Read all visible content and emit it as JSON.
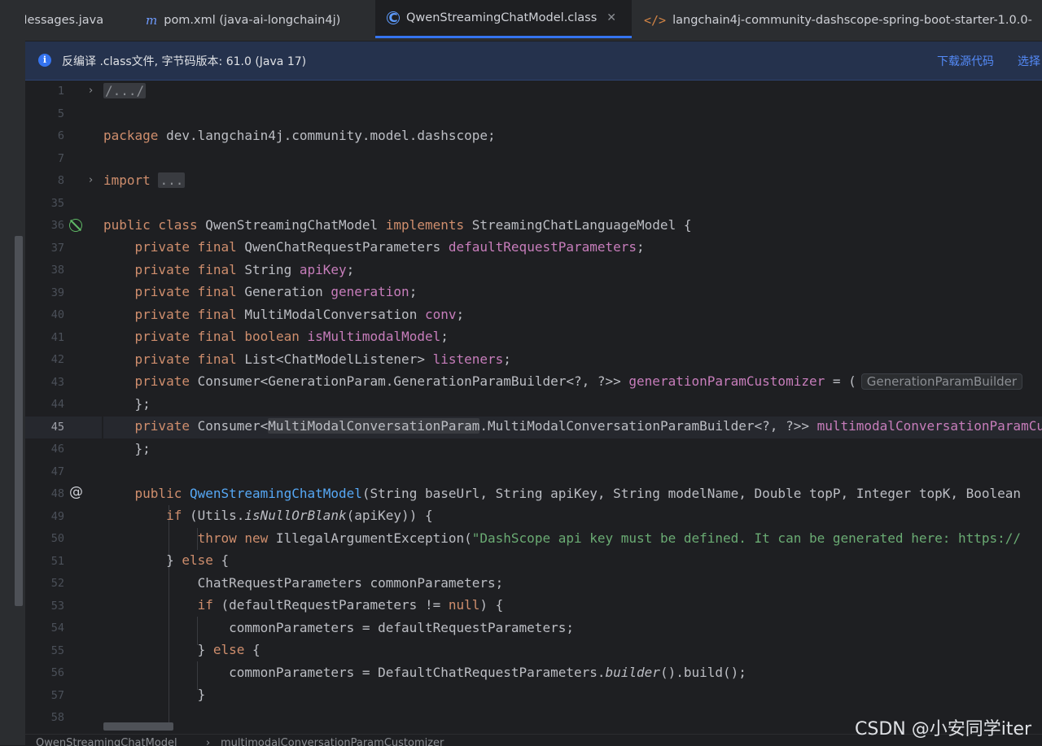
{
  "tabs": [
    {
      "label": "Messages.java",
      "icon": "java-file-icon"
    },
    {
      "label": "pom.xml (java-ai-longchain4j)",
      "icon": "maven-icon"
    },
    {
      "label": "QwenStreamingChatModel.class",
      "icon": "class-icon",
      "active": true
    },
    {
      "label": "langchain4j-community-dashscope-spring-boot-starter-1.0.0-",
      "icon": "xml-icon"
    }
  ],
  "banner": {
    "text": "反编译 .class文件, 字节码版本: 61.0 (Java 17)",
    "download_link": "下载源代码",
    "choose_link": "选择"
  },
  "line_numbers": [
    "1",
    "5",
    "6",
    "7",
    "8",
    "35",
    "36",
    "37",
    "38",
    "39",
    "40",
    "41",
    "42",
    "43",
    "44",
    "45",
    "46",
    "47",
    "48",
    "49",
    "50",
    "51",
    "52",
    "53",
    "54",
    "55",
    "56",
    "57",
    "58"
  ],
  "current_line": "45",
  "code": {
    "l1_fold": "/.../",
    "l6_kw": "package",
    "l6_rest": " dev.langchain4j.community.model.dashscope;",
    "l8_kw": "import",
    "l8_fold": "...",
    "l36_a": "public class",
    "l36_b": " QwenStreamingChatModel ",
    "l36_c": "implements",
    "l36_d": " StreamingChatLanguageModel {",
    "pf": "private final",
    "p": "private",
    "l37_type": " QwenChatRequestParameters ",
    "l37_field": "defaultRequestParameters",
    "semi": ";",
    "l38_type": " String ",
    "l38_field": "apiKey",
    "l39_type": " Generation ",
    "l39_field": "generation",
    "l40_type": " MultiModalConversation ",
    "l40_field": "conv",
    "l41_type": "boolean",
    "l41_field": "isMultimodalModel",
    "l42_type": " List<ChatModelListener> ",
    "l42_field": "listeners",
    "l43_type": " Consumer<GenerationParam.GenerationParamBuilder<?, ?>> ",
    "l43_field": "generationParamCustomizer",
    "l43_rest": " = (",
    "l43_hint": "GenerationParamBuilder",
    "close_brace": "};",
    "l45_a": " Consumer<",
    "l45_hl": "MultiModalConversationParam",
    "l45_b": ".MultiModalConversationParamBuilder<?, ?>> ",
    "l45_field": "multimodalConversationParamCustomizer",
    "l48_kw": "public",
    "l48_fn": "QwenStreamingChatModel",
    "l48_rest": "(String baseUrl, String apiKey, String modelName, Double topP, Integer topK, Boolean",
    "l49_kw": "if",
    "l49_a": " (Utils.",
    "l49_it": "isNullOrBlank",
    "l49_b": "(apiKey)) {",
    "l50_kw": "throw new",
    "l50_a": " IllegalArgumentException(",
    "l50_str": "\"DashScope api key must be defined. It can be generated here: https://",
    "l51_a": "} ",
    "l51_kw": "else",
    "l51_b": " {",
    "l52": "ChatRequestParameters commonParameters;",
    "l53_kw": "if",
    "l53_a": " (defaultRequestParameters != ",
    "l53_null": "null",
    "l53_b": ") {",
    "l54": "commonParameters = defaultRequestParameters;",
    "l55_a": "} ",
    "l55_kw": "else",
    "l55_b": " {",
    "l56_a": "commonParameters = DefaultChatRequestParameters.",
    "l56_it": "builder",
    "l56_b": "().build();",
    "l57": "}"
  },
  "breadcrumb": [
    "QwenStreamingChatModel",
    "multimodalConversationParamCustomizer"
  ],
  "watermark": "CSDN @小安同学iter",
  "colors": {
    "keyword": "#cf8e6d",
    "field": "#c77dbb",
    "function": "#56a8f5",
    "string": "#6aab73",
    "accent": "#3574f0"
  }
}
